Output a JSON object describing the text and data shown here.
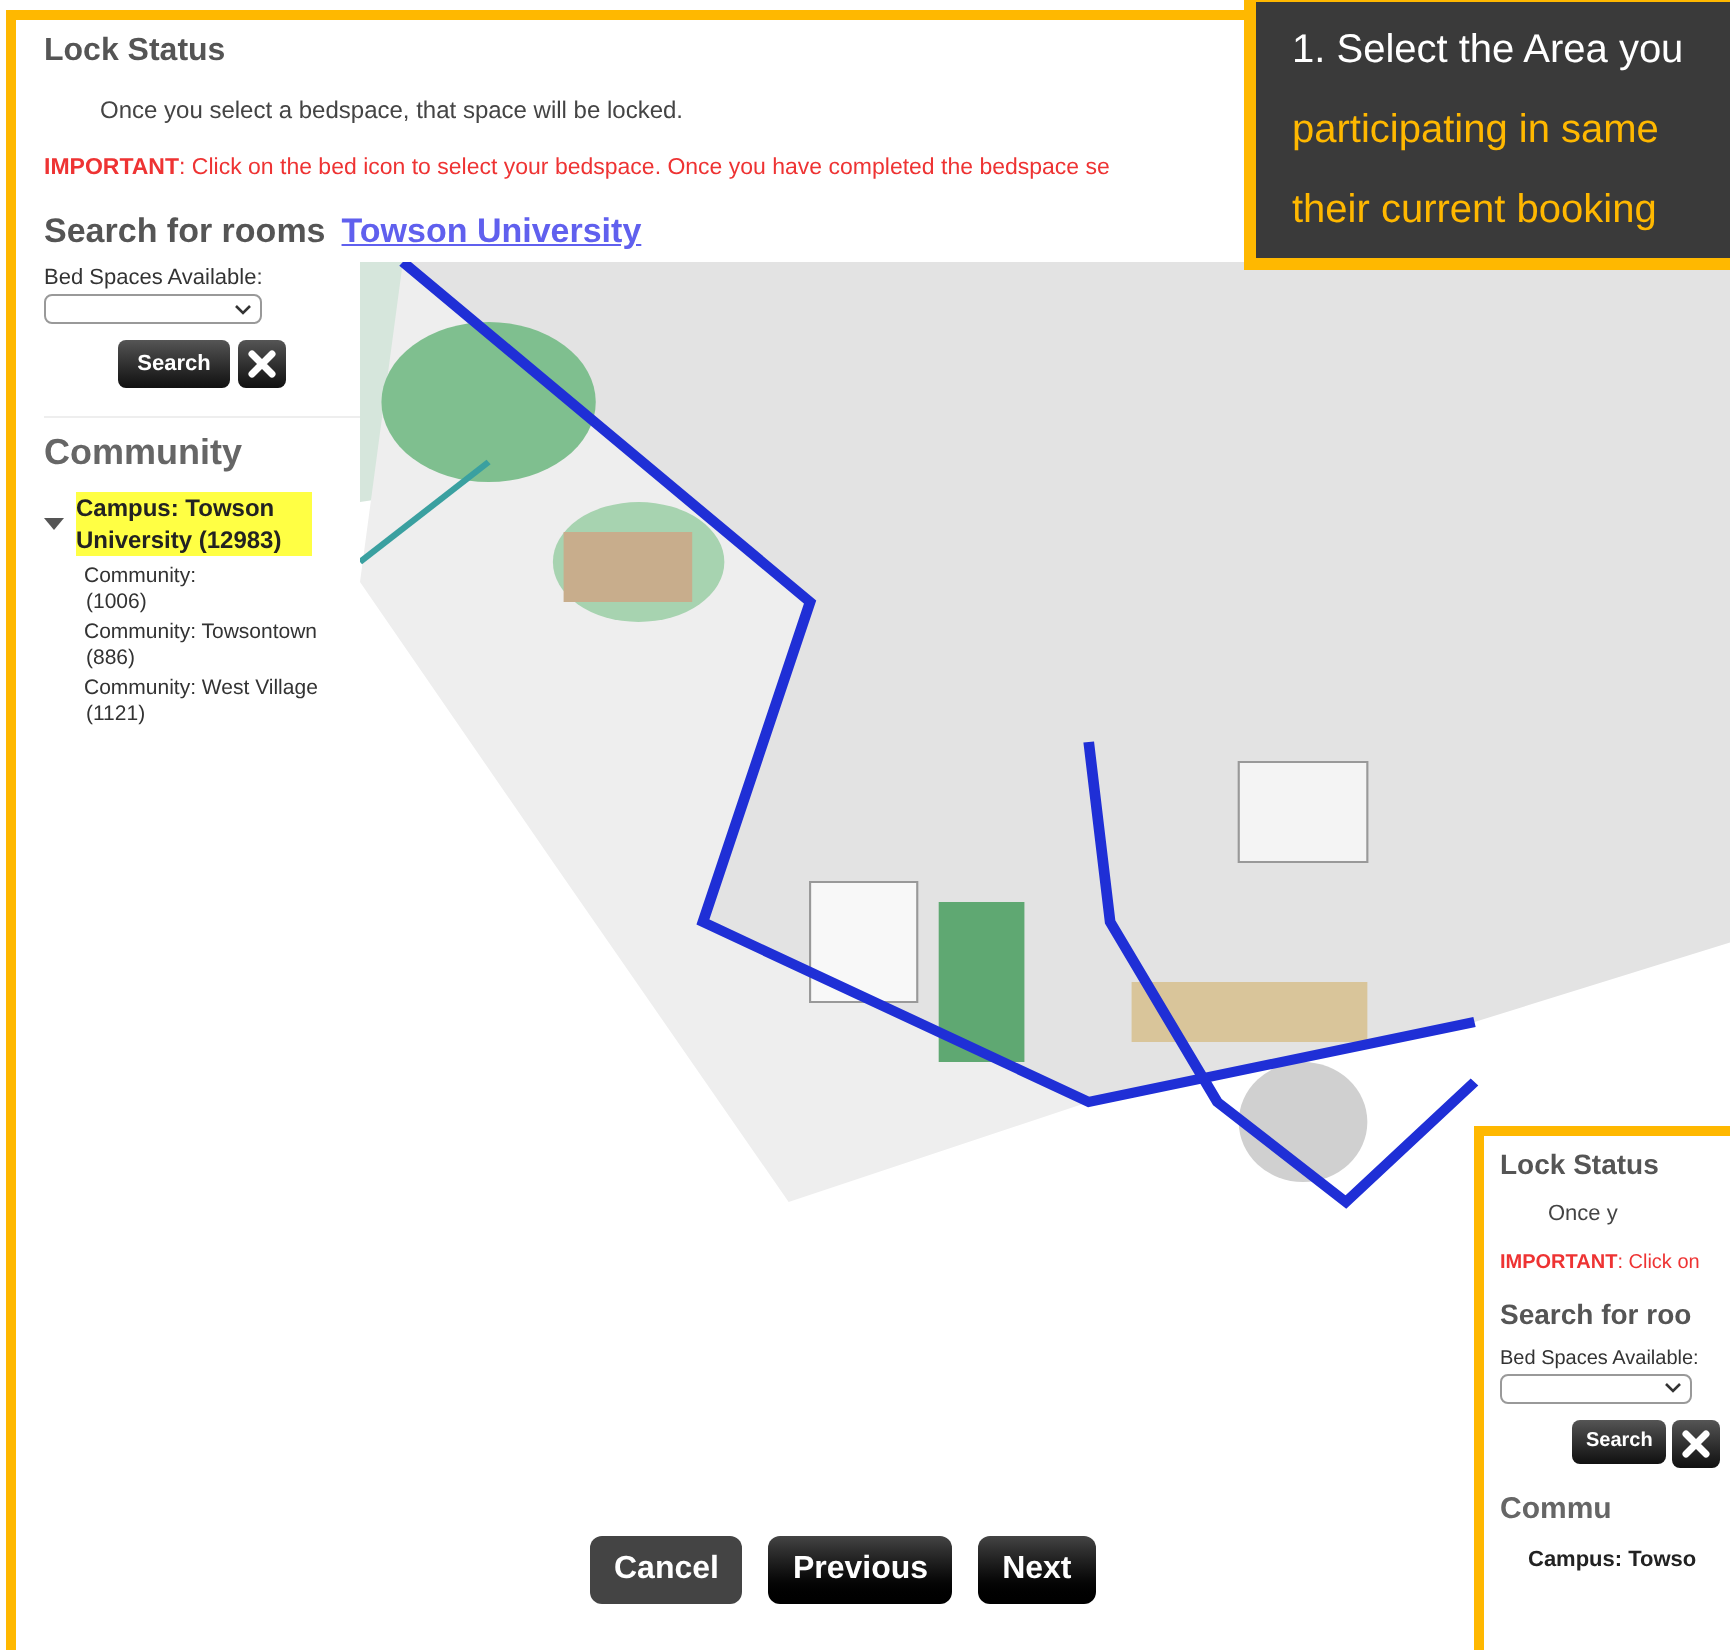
{
  "callout": {
    "lines": [
      {
        "text": "1. Select the Area you",
        "kind": "plain"
      },
      {
        "text": "participating in same",
        "kind": "accent"
      },
      {
        "text": "their current booking",
        "kind": "accent"
      }
    ]
  },
  "lock_status": {
    "title": "Lock Status",
    "message": "Once you select a bedspace, that space will be locked.",
    "important_label": "IMPORTANT",
    "important_text": ": Click on the bed icon to select your bedspace. Once you have completed the bedspace se"
  },
  "search": {
    "title": "Search for rooms",
    "link": "Towson University",
    "bed_spaces_label": "Bed Spaces Available:",
    "button": "Search"
  },
  "community": {
    "title": "Community",
    "tree": [
      {
        "label": "Campus: Towson University (12983)",
        "expanded": true,
        "selected": true,
        "children": [
          {
            "label": "Community:",
            "count": "(1006)",
            "selected": false
          },
          {
            "label": "Community: Towsontown",
            "count": "(886)",
            "selected": false
          },
          {
            "label": "Community: West Village",
            "count": "(1121)",
            "selected": false
          }
        ]
      }
    ]
  },
  "buttons": [
    {
      "label": "Cancel",
      "kind": "secondary"
    },
    {
      "label": "Previous",
      "kind": "primary"
    },
    {
      "label": "Next",
      "kind": "primary"
    }
  ],
  "inset": {
    "lock_title": "Lock Status",
    "message": "Once y",
    "important_label": "IMPORTANT",
    "important_text": ": Click on",
    "search_title": "Search for roo",
    "bed_spaces_label": "Bed Spaces Available:",
    "button": "Search",
    "community_title": "Commu",
    "campus": "Campus: Towso"
  }
}
